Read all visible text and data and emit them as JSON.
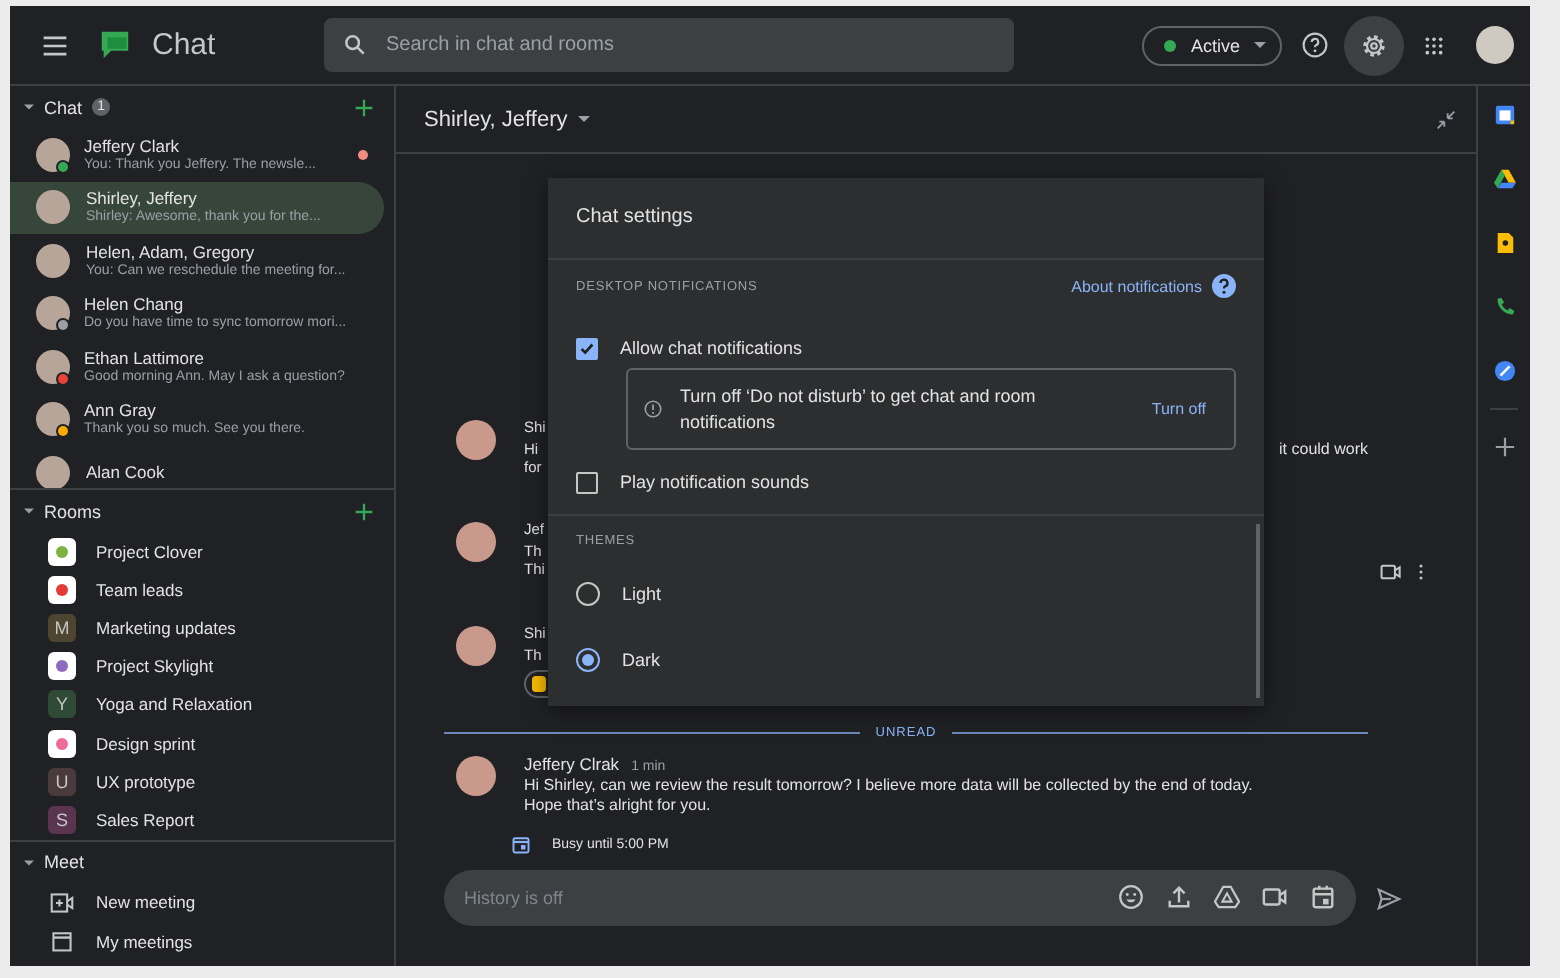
{
  "app": {
    "title": "Chat"
  },
  "search": {
    "placeholder": "Search in chat and rooms"
  },
  "status": {
    "label": "Active",
    "color": "#34a853"
  },
  "chat_section": {
    "title": "Chat",
    "badge": "1",
    "expanded": true
  },
  "chats": [
    {
      "name": "Jeffery Clark",
      "preview": "You: Thank you Jeffery. The newsle...",
      "selected": false,
      "unread": true,
      "color": "#34a853"
    },
    {
      "name": "Shirley, Jeffery",
      "preview": "Shirley: Awesome, thank you for the...",
      "selected": true,
      "unread": false
    },
    {
      "name": "Helen, Adam, Gregory",
      "preview": "You: Can we reschedule the meeting for...",
      "selected": false,
      "unread": false
    },
    {
      "name": "Helen Chang",
      "preview": "Do you have time to sync tomorrow mori...",
      "selected": false,
      "unread": false,
      "color": "#9aa0a6"
    },
    {
      "name": "Ethan Lattimore",
      "preview": "Good morning Ann. May I ask a question?",
      "selected": false,
      "unread": false,
      "color": "#ea4335"
    },
    {
      "name": "Ann Gray",
      "preview": "Thank you so much. See you there.",
      "selected": false,
      "unread": false,
      "color": "#f9ab00"
    },
    {
      "name": "Alan Cook",
      "selected": false,
      "unread": false
    }
  ],
  "rooms_section": {
    "title": "Rooms",
    "expanded": true
  },
  "rooms": [
    {
      "name": "Project Clover",
      "kind": "image",
      "color": "#7cb342"
    },
    {
      "name": "Team leads",
      "kind": "image",
      "color": "#e53935"
    },
    {
      "name": "Marketing updates",
      "kind": "letter",
      "letter": "M",
      "color": "#4d4530"
    },
    {
      "name": "Project Skylight",
      "kind": "image",
      "color": "#8e6bbf"
    },
    {
      "name": "Yoga and Relaxation",
      "kind": "letter",
      "letter": "Y",
      "color": "#2f4a35"
    },
    {
      "name": "Design sprint",
      "kind": "image",
      "color": "#ef6c9a"
    },
    {
      "name": "UX prototype",
      "kind": "letter",
      "letter": "U",
      "color": "#4a3a3c"
    },
    {
      "name": "Sales Report",
      "kind": "letter",
      "letter": "S",
      "color": "#5a3550"
    }
  ],
  "meet_section": {
    "title": "Meet",
    "expanded": true
  },
  "meet_items": [
    {
      "label": "New meeting",
      "kind": "video"
    },
    {
      "label": "My meetings",
      "kind": "calendar"
    }
  ],
  "conversation": {
    "title": "Shirley, Jeffery"
  },
  "messages": [
    {
      "fragments": [
        "Shi",
        "Hi",
        "for"
      ],
      "right_text": "it could work",
      "reaction": false,
      "actions": false
    },
    {
      "fragments": [
        "Jef",
        "Th",
        "Thi"
      ],
      "reaction": false,
      "actions": true
    },
    {
      "fragments": [
        "Shi",
        "Th"
      ],
      "reaction": true,
      "actions": false
    }
  ],
  "unread_label": "UNREAD",
  "last_message": {
    "author": "Jeffery Clrak",
    "time": "1 min",
    "lines": [
      "Hi Shirley, can we review the result tomorrow? I believe more data will be collected by the end of today.",
      "Hope that’s alright for you."
    ]
  },
  "busy": {
    "label": "Busy until 5:00 PM"
  },
  "composer": {
    "placeholder": "History is off"
  },
  "settings_dialog": {
    "title": "Chat settings",
    "notifications_heading": "DESKTOP NOTIFICATIONS",
    "about_link": "About notifications",
    "options": [
      {
        "label": "Allow chat notifications",
        "checked": true
      },
      {
        "label": "Play notification sounds",
        "checked": false
      }
    ],
    "notice": {
      "text": "Turn off ‘Do not disturb’ to get chat and room notifications",
      "button": "Turn off"
    },
    "themes_heading": "THEMES",
    "themes": [
      {
        "label": "Light",
        "selected": false
      },
      {
        "label": "Dark",
        "selected": true
      }
    ]
  }
}
